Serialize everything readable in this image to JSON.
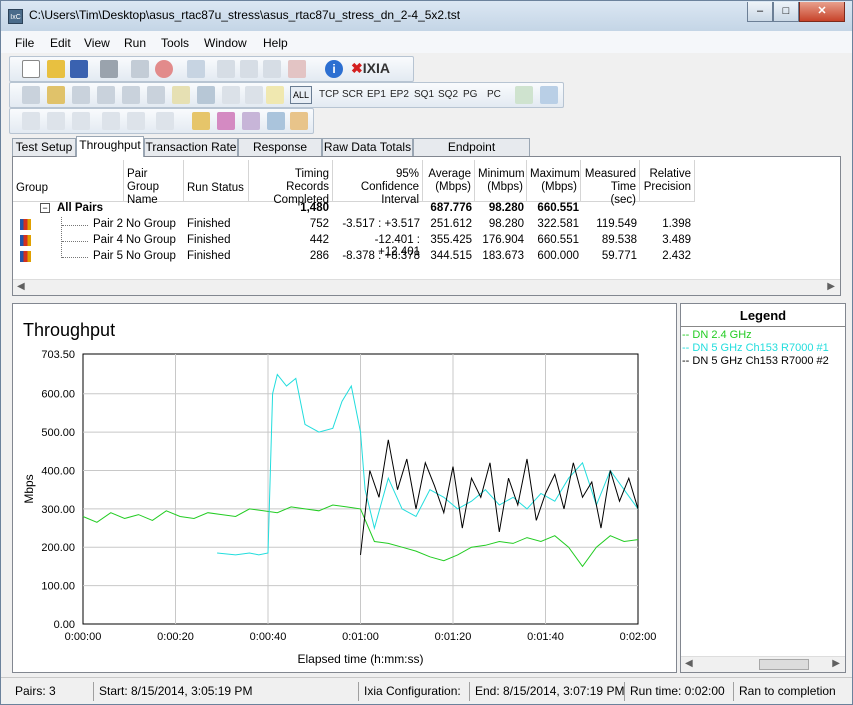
{
  "window": {
    "title": "C:\\Users\\Tim\\Desktop\\asus_rtac87u_stress\\asus_rtac87u_stress_dn_2-4_5x2.tst",
    "icon_label": "IxC"
  },
  "menu": [
    "File",
    "Edit",
    "View",
    "Run",
    "Tools",
    "Window",
    "Help"
  ],
  "toolbar2_labels": {
    "all": "ALL",
    "tcp": "TCP",
    "scr": "SCR",
    "ep1": "EP1",
    "ep2": "EP2",
    "sq1": "SQ1",
    "sq2": "SQ2",
    "pg": "PG",
    "pc": "PC"
  },
  "brand": "IXIA",
  "tabs": [
    "Test Setup",
    "Throughput",
    "Transaction Rate",
    "Response Time",
    "Raw Data Totals",
    "Endpoint Configuration"
  ],
  "table": {
    "headers": {
      "group": "Group",
      "pair_group_name": "Pair Group Name",
      "run_status": "Run Status",
      "timing": "Timing Records Completed",
      "confidence": "95% Confidence Interval",
      "average": "Average (Mbps)",
      "minimum": "Minimum (Mbps)",
      "maximum": "Maximum (Mbps)",
      "measured": "Measured Time (sec)",
      "precision": "Relative Precision"
    },
    "all_pairs": {
      "label": "All Pairs",
      "timing": "1,480",
      "average": "687.776",
      "minimum": "98.280",
      "maximum": "660.551"
    },
    "rows": [
      {
        "pair": "Pair 2",
        "group": "No Group",
        "status": "Finished",
        "timing": "752",
        "ci": "-3.517 : +3.517",
        "avg": "251.612",
        "min": "98.280",
        "max": "322.581",
        "time": "119.549",
        "prec": "1.398"
      },
      {
        "pair": "Pair 4",
        "group": "No Group",
        "status": "Finished",
        "timing": "442",
        "ci": "-12.401 : +12.401",
        "avg": "355.425",
        "min": "176.904",
        "max": "660.551",
        "time": "89.538",
        "prec": "3.489"
      },
      {
        "pair": "Pair 5",
        "group": "No Group",
        "status": "Finished",
        "timing": "286",
        "ci": "-8.378 : +8.378",
        "avg": "344.515",
        "min": "183.673",
        "max": "600.000",
        "time": "59.771",
        "prec": "2.432"
      }
    ]
  },
  "chart_data": {
    "type": "line",
    "title": "Throughput",
    "xlabel": "Elapsed time (h:mm:ss)",
    "ylabel": "Mbps",
    "ylim": [
      0,
      703.5
    ],
    "xlim_sec": [
      0,
      120
    ],
    "yticks": [
      "0.00",
      "100.00",
      "200.00",
      "300.00",
      "400.00",
      "500.00",
      "600.00",
      "703.50"
    ],
    "xticks": [
      "0:00:00",
      "0:00:20",
      "0:00:40",
      "0:01:00",
      "0:01:20",
      "0:01:40",
      "0:02:00"
    ],
    "grid": true,
    "series": [
      {
        "name": "DN 2.4 GHz",
        "color": "#22cc22",
        "x": [
          0,
          3,
          6,
          9,
          12,
          15,
          18,
          21,
          24,
          27,
          30,
          33,
          36,
          39,
          42,
          45,
          48,
          51,
          54,
          57,
          60,
          63,
          66,
          69,
          72,
          75,
          78,
          81,
          84,
          87,
          90,
          93,
          96,
          99,
          102,
          105,
          108,
          111,
          114,
          117,
          120
        ],
        "y": [
          280,
          265,
          290,
          275,
          285,
          270,
          295,
          280,
          275,
          290,
          285,
          280,
          300,
          295,
          290,
          305,
          300,
          295,
          310,
          305,
          300,
          215,
          210,
          200,
          190,
          175,
          165,
          180,
          200,
          205,
          215,
          210,
          225,
          215,
          230,
          200,
          150,
          200,
          230,
          215,
          220
        ]
      },
      {
        "name": "DN 5 GHz Ch153 R7000 #1",
        "color": "#22dddd",
        "x": [
          29,
          33,
          36,
          38,
          40,
          41,
          42,
          44,
          46,
          48,
          51,
          54,
          56,
          58,
          60,
          61,
          63,
          66,
          69,
          72,
          75,
          78,
          81,
          84,
          87,
          90,
          93,
          96,
          99,
          102,
          105,
          108,
          111,
          114,
          117,
          120
        ],
        "y": [
          185,
          180,
          185,
          180,
          185,
          600,
          650,
          620,
          640,
          520,
          500,
          510,
          580,
          620,
          500,
          350,
          250,
          380,
          300,
          280,
          350,
          330,
          300,
          320,
          350,
          310,
          330,
          300,
          340,
          320,
          380,
          420,
          310,
          400,
          350,
          300
        ]
      },
      {
        "name": "DN 5 GHz Ch153 R7000 #2",
        "color": "#000000",
        "x": [
          60,
          62,
          64,
          66,
          68,
          70,
          72,
          74,
          76,
          78,
          80,
          82,
          84,
          86,
          88,
          90,
          92,
          94,
          96,
          98,
          100,
          102,
          104,
          106,
          108,
          110,
          112,
          114,
          116,
          118,
          120
        ],
        "y": [
          180,
          400,
          330,
          480,
          350,
          430,
          300,
          420,
          360,
          290,
          410,
          250,
          380,
          330,
          420,
          240,
          380,
          310,
          430,
          270,
          340,
          390,
          300,
          420,
          330,
          370,
          250,
          400,
          320,
          380,
          300
        ]
      }
    ]
  },
  "legend": {
    "title": "Legend",
    "items": [
      "DN 2.4 GHz",
      "DN 5 GHz Ch153 R7000 #1",
      "DN 5 GHz Ch153 R7000 #2"
    ]
  },
  "status": {
    "pairs": "Pairs: 3",
    "start": "Start: 8/15/2014, 3:05:19 PM",
    "ixia": "Ixia Configuration:",
    "end": "End: 8/15/2014, 3:07:19 PM",
    "run": "Run time: 0:02:00",
    "completion": "Ran to completion"
  }
}
